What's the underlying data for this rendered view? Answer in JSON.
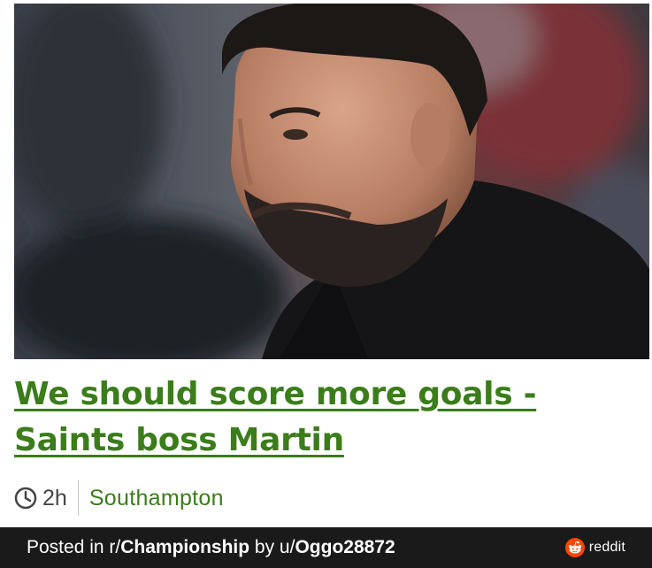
{
  "article": {
    "headline": "We should score more goals - Saints boss Martin",
    "age": "2h",
    "section": "Southampton"
  },
  "footer": {
    "posted_prefix": "Posted in r/",
    "subreddit": "Championship",
    "by_prefix": " by u/",
    "username": "Oggo28872",
    "brand": "reddit"
  },
  "colors": {
    "headline": "#3a7d1a",
    "footer_bg": "#1a1a1a",
    "reddit_orange": "#ff4500"
  },
  "icons": {
    "clock": "clock-icon",
    "reddit": "reddit-logo-icon"
  }
}
